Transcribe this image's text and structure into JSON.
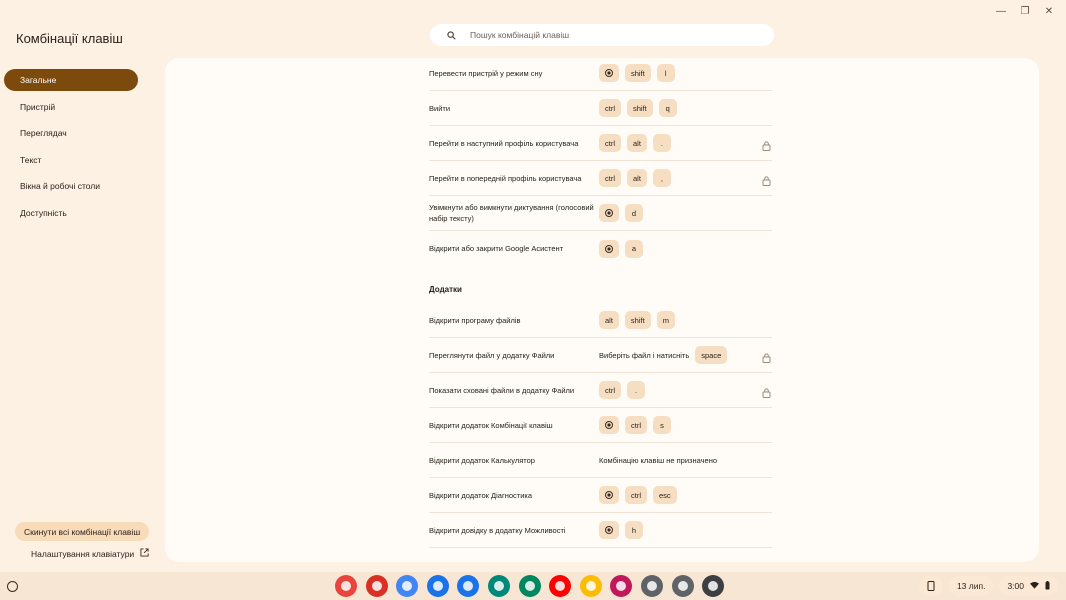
{
  "app_title": "Комбінації клавіш",
  "search": {
    "placeholder": "Пошук комбінацій клавіш"
  },
  "sidebar": {
    "items": [
      {
        "label": "Загальне",
        "active": true
      },
      {
        "label": "Пристрій"
      },
      {
        "label": "Переглядач"
      },
      {
        "label": "Текст"
      },
      {
        "label": "Вікна й робочі столи"
      },
      {
        "label": "Доступність"
      }
    ],
    "reset_button": "Скинути всі комбінації клавіш",
    "keyboard_settings": "Налаштування клавіатури"
  },
  "general_rows": [
    {
      "label": "Перевести пристрій у режим сну",
      "keys": [
        "launcher",
        "shift",
        "l"
      ]
    },
    {
      "label": "Вийти",
      "keys": [
        "ctrl",
        "shift",
        "q"
      ]
    },
    {
      "label": "Перейти в наступний профіль користувача",
      "keys": [
        "ctrl",
        "alt",
        "."
      ],
      "locked": true
    },
    {
      "label": "Перейти в попередній профіль користувача",
      "keys": [
        "ctrl",
        "alt",
        ","
      ],
      "locked": true
    },
    {
      "label": "Увімкнути або вимкнути диктування (голосовий набір тексту)",
      "keys": [
        "launcher",
        "d"
      ]
    },
    {
      "label": "Відкрити або закрити Google Асистент",
      "keys": [
        "launcher",
        "a"
      ]
    }
  ],
  "apps_section": {
    "title": "Додатки",
    "rows": [
      {
        "label": "Відкрити програму файлів",
        "keys": [
          "alt",
          "shift",
          "m"
        ]
      },
      {
        "label": "Переглянути файл у додатку Файли",
        "text": "Виберіть файл і натисніть",
        "keys": [
          "space"
        ],
        "locked": true
      },
      {
        "label": "Показати сховані файли в додатку Файли",
        "keys": [
          "ctrl",
          "."
        ],
        "locked": true
      },
      {
        "label": "Відкрити додаток Комбінації клавіш",
        "keys": [
          "launcher",
          "ctrl",
          "s"
        ]
      },
      {
        "label": "Відкрити додаток Калькулятор",
        "text": "Комбінацію клавіш не призначено",
        "keys": []
      },
      {
        "label": "Відкрити додаток Діагностика",
        "keys": [
          "launcher",
          "ctrl",
          "esc"
        ]
      },
      {
        "label": "Відкрити довідку в додатку Можливості",
        "keys": [
          "launcher",
          "h"
        ]
      }
    ]
  },
  "shelf": {
    "apps": [
      {
        "name": "chrome",
        "color": "#e8453c"
      },
      {
        "name": "gmail",
        "color": "#d93025"
      },
      {
        "name": "docs",
        "color": "#4285f4"
      },
      {
        "name": "files",
        "color": "#1a73e8"
      },
      {
        "name": "messages",
        "color": "#1a73e8"
      },
      {
        "name": "meet",
        "color": "#00897b"
      },
      {
        "name": "play-store",
        "color": "#01875f"
      },
      {
        "name": "youtube",
        "color": "#ff0000"
      },
      {
        "name": "photos",
        "color": "#fbbc04"
      },
      {
        "name": "shortcuts",
        "color": "#c2185b"
      },
      {
        "name": "camera",
        "color": "#5f6368"
      },
      {
        "name": "settings",
        "color": "#5f6368"
      },
      {
        "name": "diagnostics",
        "color": "#3c4043"
      }
    ],
    "date": "13 лип.",
    "time": "3:00"
  },
  "colors": {
    "accent": "#7c4a0d",
    "key_bg": "#f6dec3",
    "background": "#fdf1e4",
    "panel": "#fffbf7"
  }
}
